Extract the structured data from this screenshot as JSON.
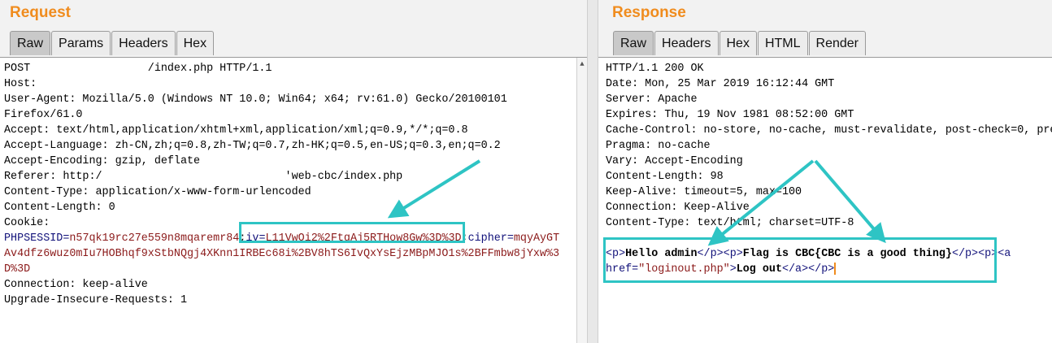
{
  "request": {
    "title": "Request",
    "tabs": [
      "Raw",
      "Params",
      "Headers",
      "Hex"
    ],
    "active_tab": "Raw",
    "lines": {
      "l1": "POST                  /index.php HTTP/1.1",
      "l2": "Host:",
      "l3": "User-Agent: Mozilla/5.0 (Windows NT 10.0; Win64; x64; rv:61.0) Gecko/20100101",
      "l4": "Firefox/61.0",
      "l5": "Accept: text/html,application/xhtml+xml,application/xml;q=0.9,*/*;q=0.8",
      "l6": "Accept-Language: zh-CN,zh;q=0.8,zh-TW;q=0.7,zh-HK;q=0.5,en-US;q=0.3,en;q=0.2",
      "l7": "Accept-Encoding: gzip, deflate",
      "l8": "Referer: http:/                            'web-cbc/index.php",
      "l9": "Content-Type: application/x-www-form-urlencoded",
      "l10": "Content-Length: 0",
      "l11": "Cookie:",
      "cookie": {
        "k1": "PHPSESSID",
        "v1": "n57qk19rc27e559n8mqaremr84",
        "sep1": ";",
        "k2": "iv",
        "v2": "L11VwOi2%2FtgAj5RTHow8Gw%3D%3D",
        "sep2": ";",
        "k3": "cipher",
        "v3": "mqyAyGT",
        "cont1": "Av4dfz6wuz0mIu7HOBhqf9xStbNQgj4XKnn1IRBEc68i%2BV8hTS6IvQxYsEjzMBpMJO1s%2BFFmbw8jYxw%3",
        "cont2": "D%3D"
      },
      "l15": "Connection: keep-alive",
      "l16": "Upgrade-Insecure-Requests: 1"
    }
  },
  "response": {
    "title": "Response",
    "tabs": [
      "Raw",
      "Headers",
      "Hex",
      "HTML",
      "Render"
    ],
    "active_tab": "Raw",
    "lines": {
      "l1": "HTTP/1.1 200 OK",
      "l2": "Date: Mon, 25 Mar 2019 16:12:44 GMT",
      "l3": "Server: Apache",
      "l4": "Expires: Thu, 19 Nov 1981 08:52:00 GMT",
      "l5": "Cache-Control: no-store, no-cache, must-revalidate, post-check=0, pre",
      "l6": "Pragma: no-cache",
      "l7": "Vary: Accept-Encoding",
      "l8": "Content-Length: 98",
      "l9": "Keep-Alive: timeout=5, max=100",
      "l10": "Connection: Keep-Alive",
      "l11": "Content-Type: text/html; charset=UTF-8"
    },
    "body": {
      "p_open1": "<p>",
      "hello": "Hello admin",
      "p_close1": "</p>",
      "p_open2": "<p>",
      "flag": "Flag is CBC{CBC is a good thing}",
      "p_close2": "</p>",
      "p_open3": "<p>",
      "a_open": "<a",
      "href_attr": "href=",
      "href_val": "\"loginout.php\"",
      "a_gt": ">",
      "logout": "Log out",
      "a_close": "</a>",
      "p_close3": "</p>"
    }
  },
  "colors": {
    "title": "#f08c1e",
    "highlight": "#2ec4c4",
    "key": "#11117a",
    "value": "#8b1a1a"
  }
}
